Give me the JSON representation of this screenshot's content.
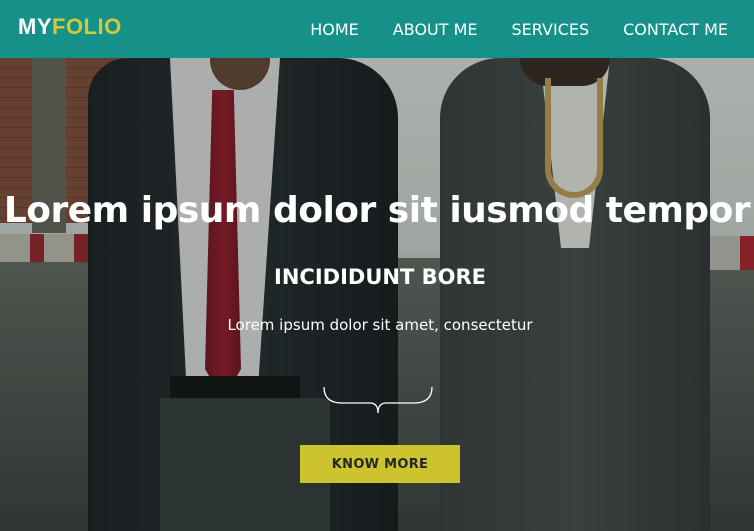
{
  "logo": {
    "part1": "MY",
    "part2": "FOLIO"
  },
  "nav": {
    "items": [
      "HOME",
      "ABOUT ME",
      "SERVICES",
      "CONTACT ME"
    ]
  },
  "hero": {
    "headline": "Lorem ipsum dolor sit iusmod tempor",
    "subheadline": "INCIDIDUNT BORE",
    "tagline": "Lorem ipsum dolor sit amet, consectetur",
    "cta_label": "KNOW MORE"
  },
  "colors": {
    "navbar": "#16918a",
    "logo_accent": "#d4c838",
    "cta": "#cdc32e"
  },
  "icons": {
    "divider": "curly-brace-icon"
  }
}
